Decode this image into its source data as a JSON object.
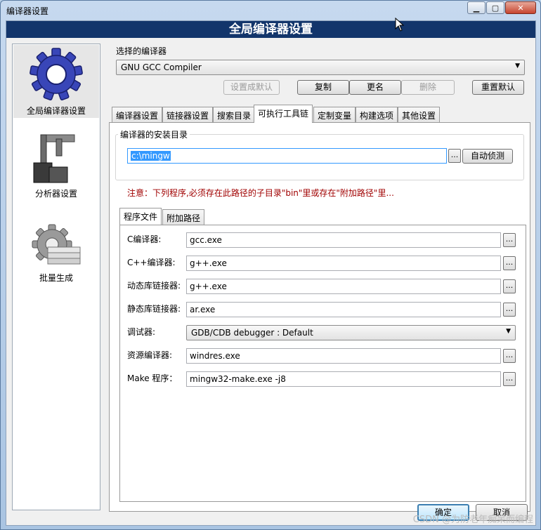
{
  "window": {
    "title": "编译器设置"
  },
  "banner": {
    "title": "全局编译器设置"
  },
  "nav": {
    "items": [
      {
        "label": "全局编译器设置",
        "icon": "gear-icon"
      },
      {
        "label": "分析器设置",
        "icon": "caliper-icon"
      },
      {
        "label": "批量生成",
        "icon": "batch-gear-icon"
      }
    ]
  },
  "compiler": {
    "label": "选择的编译器",
    "selected": "GNU GCC Compiler",
    "buttons": {
      "set_default": "设置成默认",
      "copy": "复制",
      "rename": "更名",
      "delete": "删除",
      "reset_default": "重置默认"
    }
  },
  "tabs": [
    "编译器设置",
    "链接器设置",
    "搜索目录",
    "可执行工具链",
    "定制变量",
    "构建选项",
    "其他设置"
  ],
  "install": {
    "group_title": "编译器的安装目录",
    "path": "c:\\mingw",
    "browse": "...",
    "autodetect": "自动侦测",
    "note": "注意：下列程序,必须存在此路径的子目录\"bin\"里或存在\"附加路径\"里..."
  },
  "inner_tabs": [
    "程序文件",
    "附加路径"
  ],
  "programs": {
    "c_compiler": {
      "label": "C编译器:",
      "value": "gcc.exe"
    },
    "cpp_compiler": {
      "label": "C++编译器:",
      "value": "g++.exe"
    },
    "dyn_linker": {
      "label": "动态库链接器:",
      "value": "g++.exe"
    },
    "static_linker": {
      "label": "静态库链接器:",
      "value": "ar.exe"
    },
    "debugger": {
      "label": "调试器:",
      "value": "GDB/CDB debugger : Default"
    },
    "res_compiler": {
      "label": "资源编译器:",
      "value": "windres.exe"
    },
    "make": {
      "label": "Make 程序：",
      "value": "mingw32-make.exe -j8"
    }
  },
  "dialog": {
    "ok": "确定",
    "cancel": "取消"
  },
  "watermark": "CSDN @为防老年痴呆而编程",
  "colors": {
    "banner": "#12356b",
    "note": "#a00000",
    "selection": "#3399ff"
  }
}
